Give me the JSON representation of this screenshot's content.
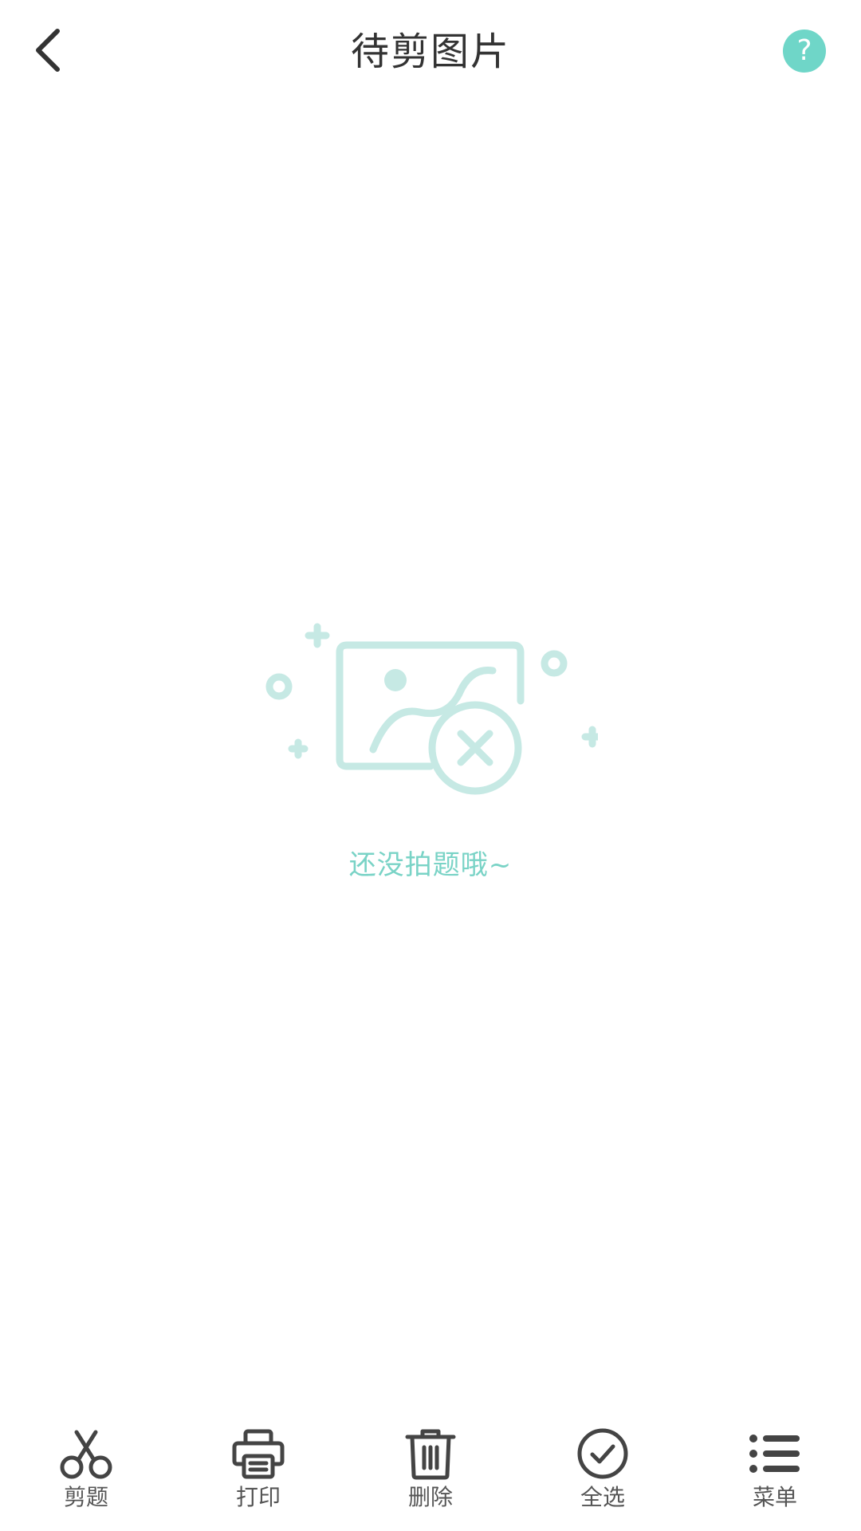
{
  "header": {
    "title": "待剪图片",
    "back_icon": "chevron-left-icon",
    "help_icon": "question-icon",
    "help_glyph": "?",
    "help_color": "#6fd6c8"
  },
  "empty_state": {
    "illustration_icon": "no-image-icon",
    "message": "还没拍题哦~",
    "color": "#79d3c6",
    "illustration_color": "#c6e9e4"
  },
  "toolbar": {
    "items": [
      {
        "label": "剪题",
        "icon": "scissors-icon"
      },
      {
        "label": "打印",
        "icon": "printer-icon"
      },
      {
        "label": "删除",
        "icon": "trash-icon"
      },
      {
        "label": "全选",
        "icon": "check-circle-icon"
      },
      {
        "label": "菜单",
        "icon": "menu-list-icon"
      }
    ],
    "icon_color": "#444444",
    "label_color": "#555555"
  }
}
